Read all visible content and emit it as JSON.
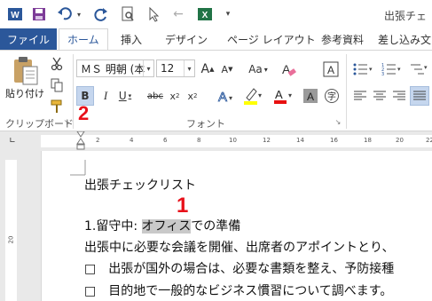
{
  "window": {
    "title": "出張チェ"
  },
  "quick_access": {
    "app_icon": "word-icon",
    "save_icon": "save-icon",
    "undo_icon": "undo-icon",
    "redo_icon": "redo-icon",
    "print_preview_icon": "print-preview-icon",
    "pointer_icon": "touch-mode-icon",
    "back_icon": "back-arrow-icon",
    "excel_icon": "excel-icon",
    "customize_icon": "customize-qat-icon"
  },
  "tabs": [
    {
      "label": "ファイル"
    },
    {
      "label": "ホーム"
    },
    {
      "label": "挿入"
    },
    {
      "label": "デザイン"
    },
    {
      "label": "ページ レイアウト"
    },
    {
      "label": "参考資料"
    },
    {
      "label": "差し込み文"
    }
  ],
  "clipboard": {
    "paste_label": "貼り付け",
    "group_label": "クリップボード"
  },
  "font": {
    "name": "ＭＳ 明朝 (本",
    "size": "12",
    "group_label": "フォント",
    "aa_label": "Aa"
  },
  "annotations": {
    "one": "1",
    "two": "2"
  },
  "ruler": {
    "marks": [
      "2",
      "4",
      "6",
      "8",
      "10",
      "12",
      "14",
      "16",
      "18",
      "20",
      "22"
    ]
  },
  "vertical_ruler": {
    "mark": "20"
  },
  "document": {
    "title": "出張チェックリスト",
    "line1_prefix": "1.留守中: ",
    "line1_highlight": "オフィス",
    "line1_suffix": "での準備",
    "line2": "出張中に必要な会議を開催、出席者のアポイントとり、",
    "line3": "□　出張が国外の場合は、必要な書類を整え、予防接種",
    "line4": "□　目的地で一般的なビジネス慣習について調べます。"
  },
  "colors": {
    "accent": "#2b579a",
    "annotation": "#e8101a",
    "highlight_yellow": "#ffff00",
    "font_red": "#e81010"
  }
}
